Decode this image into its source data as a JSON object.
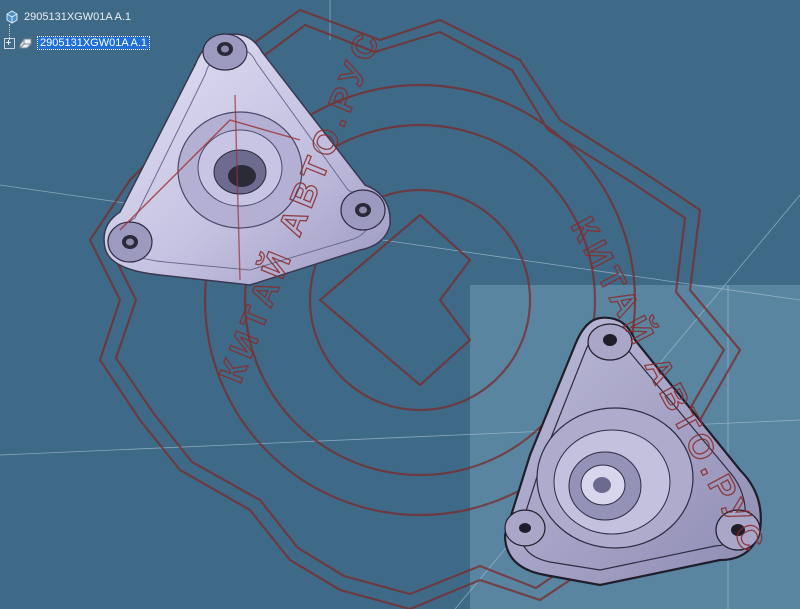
{
  "tree": {
    "root_label": "2905131XGW01A A.1",
    "child_label": "2905131XGW01A A.1"
  },
  "watermark": {
    "text_top": "КИТАЙ АВТО.РУС",
    "text_bottom": "КИТАЙ АВТО.РУС"
  },
  "colors": {
    "background": "#3f6a87",
    "highlight_panel": "#5f8aa6",
    "part_fill": "#c9c6e4",
    "part_edge": "#2a2a3a",
    "watermark": "#7a2a2a"
  },
  "icons": {
    "product": "product-icon",
    "part": "part-icon"
  }
}
